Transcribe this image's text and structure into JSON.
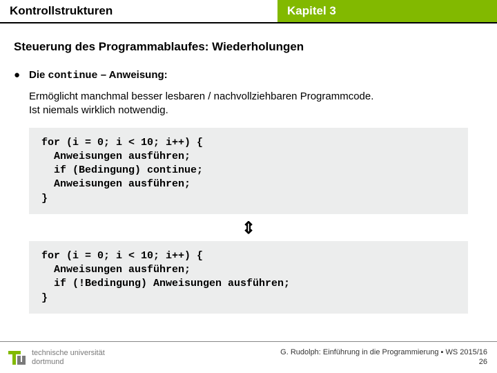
{
  "header": {
    "left": "Kontrollstrukturen",
    "right": "Kapitel 3"
  },
  "heading": "Steuerung des Programmablaufes: Wiederholungen",
  "bullet": {
    "prefix": "Die ",
    "keyword": "continue",
    "suffix": " – Anweisung:"
  },
  "body": {
    "line1": "Ermöglicht manchmal besser lesbaren / nachvollziehbaren Programmcode.",
    "line2": "Ist niemals wirklich notwendig."
  },
  "code1": "for (i = 0; i < 10; i++) {\n  Anweisungen ausführen;\n  if (Bedingung) continue;\n  Anweisungen ausführen;\n}",
  "equiv": "⇕",
  "code2": "for (i = 0; i < 10; i++) {\n  Anweisungen ausführen;\n  if (!Bedingung) Anweisungen ausführen;\n}",
  "footer": {
    "uni1": "technische universität",
    "uni2": "dortmund",
    "credit": "G. Rudolph: Einführung in die Programmierung ▪ WS 2015/16",
    "page": "26"
  }
}
